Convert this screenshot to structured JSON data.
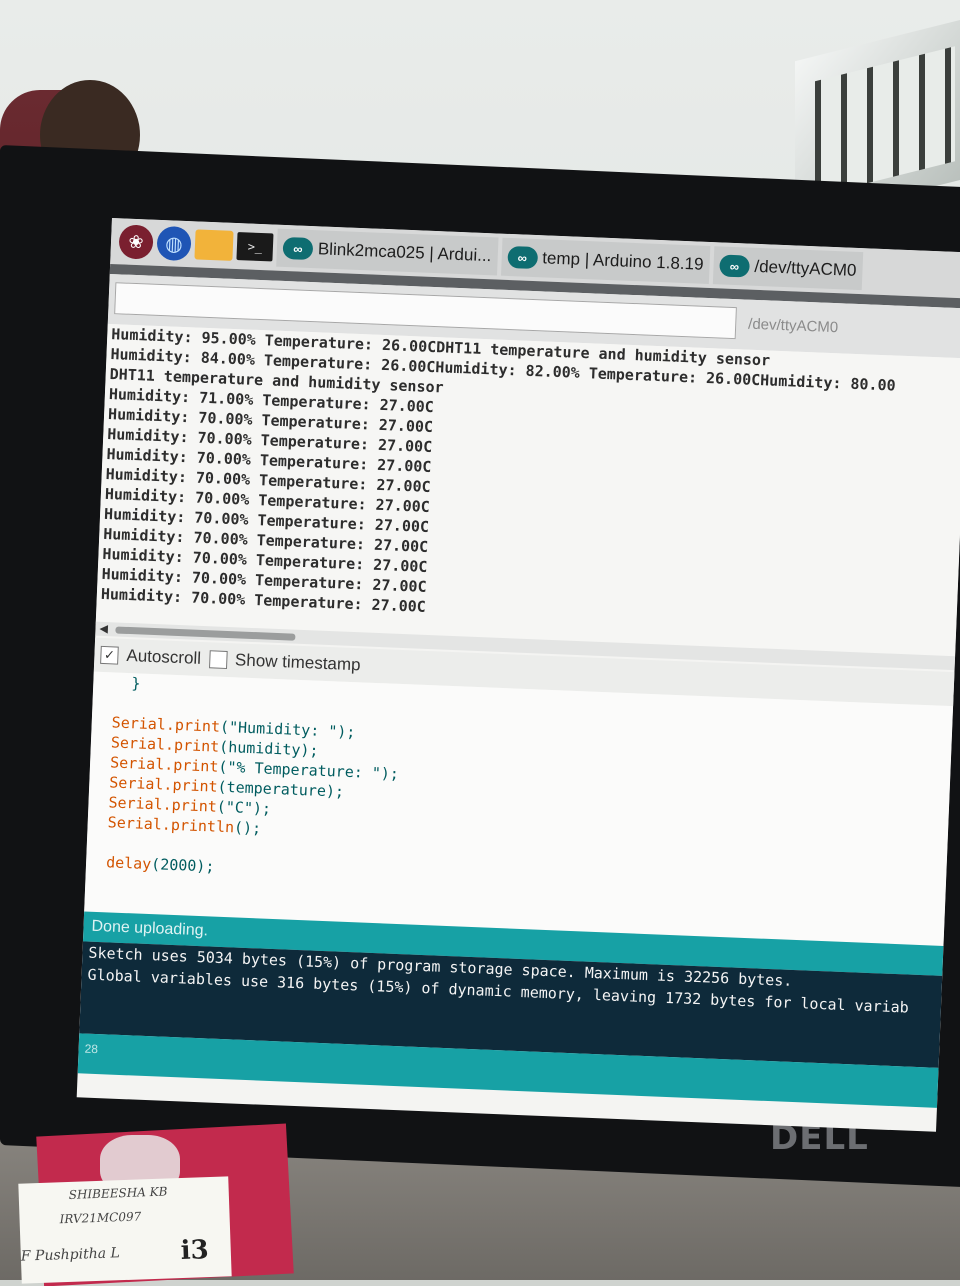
{
  "taskbar": {
    "tabs": [
      {
        "label": "Blink2mca025 | Ardui...",
        "logo": "∞"
      },
      {
        "label": "temp | Arduino 1.8.19",
        "logo": "∞"
      },
      {
        "label": "/dev/ttyACM0",
        "logo": "∞"
      }
    ]
  },
  "serial_monitor": {
    "port_label": "/dev/ttyACM0",
    "output_lines": [
      "Humidity: 95.00% Temperature: 26.00CDHT11 temperature and humidity sensor",
      "Humidity: 84.00% Temperature: 26.00CHumidity: 82.00% Temperature: 26.00CHumidity: 80.00",
      "DHT11 temperature and humidity sensor",
      "Humidity: 71.00% Temperature: 27.00C",
      "Humidity: 70.00% Temperature: 27.00C",
      "Humidity: 70.00% Temperature: 27.00C",
      "Humidity: 70.00% Temperature: 27.00C",
      "Humidity: 70.00% Temperature: 27.00C",
      "Humidity: 70.00% Temperature: 27.00C",
      "Humidity: 70.00% Temperature: 27.00C",
      "Humidity: 70.00% Temperature: 27.00C",
      "Humidity: 70.00% Temperature: 27.00C",
      "Humidity: 70.00% Temperature: 27.00C",
      "Humidity: 70.00% Temperature: 27.00C"
    ],
    "autoscroll_label": "Autoscroll",
    "autoscroll_checked": true,
    "timestamp_label": "Show timestamp",
    "timestamp_checked": false
  },
  "editor": {
    "code": [
      {
        "kw": "",
        "rest": "  }"
      },
      {
        "kw": "",
        "rest": ""
      },
      {
        "kw": "Serial.print",
        "rest": "(\"Humidity: \");"
      },
      {
        "kw": "Serial.print",
        "rest": "(humidity);"
      },
      {
        "kw": "Serial.print",
        "rest": "(\"% Temperature: \");"
      },
      {
        "kw": "Serial.print",
        "rest": "(temperature);"
      },
      {
        "kw": "Serial.print",
        "rest": "(\"C\");"
      },
      {
        "kw": "Serial.println",
        "rest": "();"
      },
      {
        "kw": "",
        "rest": ""
      },
      {
        "kw": "delay",
        "rest": "(2000);"
      }
    ]
  },
  "status": {
    "message": "Done uploading.",
    "console_lines": [
      "Sketch uses 5034 bytes (15%) of program storage space. Maximum is 32256 bytes.",
      "Global variables use 316 bytes (15%) of dynamic memory, leaving 1732 bytes for local variab"
    ],
    "line_number": "28"
  },
  "monitor_brand": "DELL",
  "stickers": {
    "line1": "SHIBEESHA KB",
    "line2": "IRV21MC097",
    "line3": "F Pushpitha L",
    "line4": "i3"
  }
}
